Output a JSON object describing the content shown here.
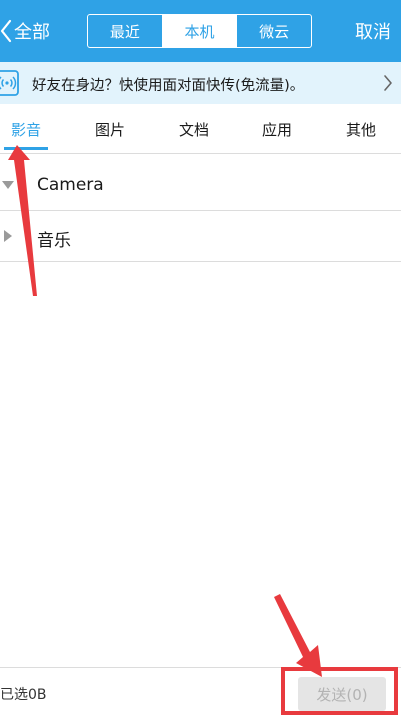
{
  "header": {
    "back_label": "全部",
    "segments": [
      "最近",
      "本机",
      "微云"
    ],
    "active_segment": "本机",
    "cancel_label": "取消"
  },
  "banner": {
    "text": "好友在身边？快使用面对面快传(免流量)。"
  },
  "tabs": [
    {
      "label": "影音",
      "active": true
    },
    {
      "label": "图片",
      "active": false
    },
    {
      "label": "文档",
      "active": false
    },
    {
      "label": "应用",
      "active": false
    },
    {
      "label": "其他",
      "active": false
    }
  ],
  "list": [
    {
      "label": "Camera",
      "expanded": true
    },
    {
      "label": "音乐",
      "expanded": false
    }
  ],
  "bottom": {
    "selected_text": "已选0B",
    "send_label": "发送(0)"
  },
  "colors": {
    "accent": "#2fa2e6",
    "banner_bg": "#e2f3fc",
    "annotation_red": "#e83a3e",
    "send_disabled_bg": "#e5e5e5",
    "send_disabled_text": "#b3b3b3"
  }
}
